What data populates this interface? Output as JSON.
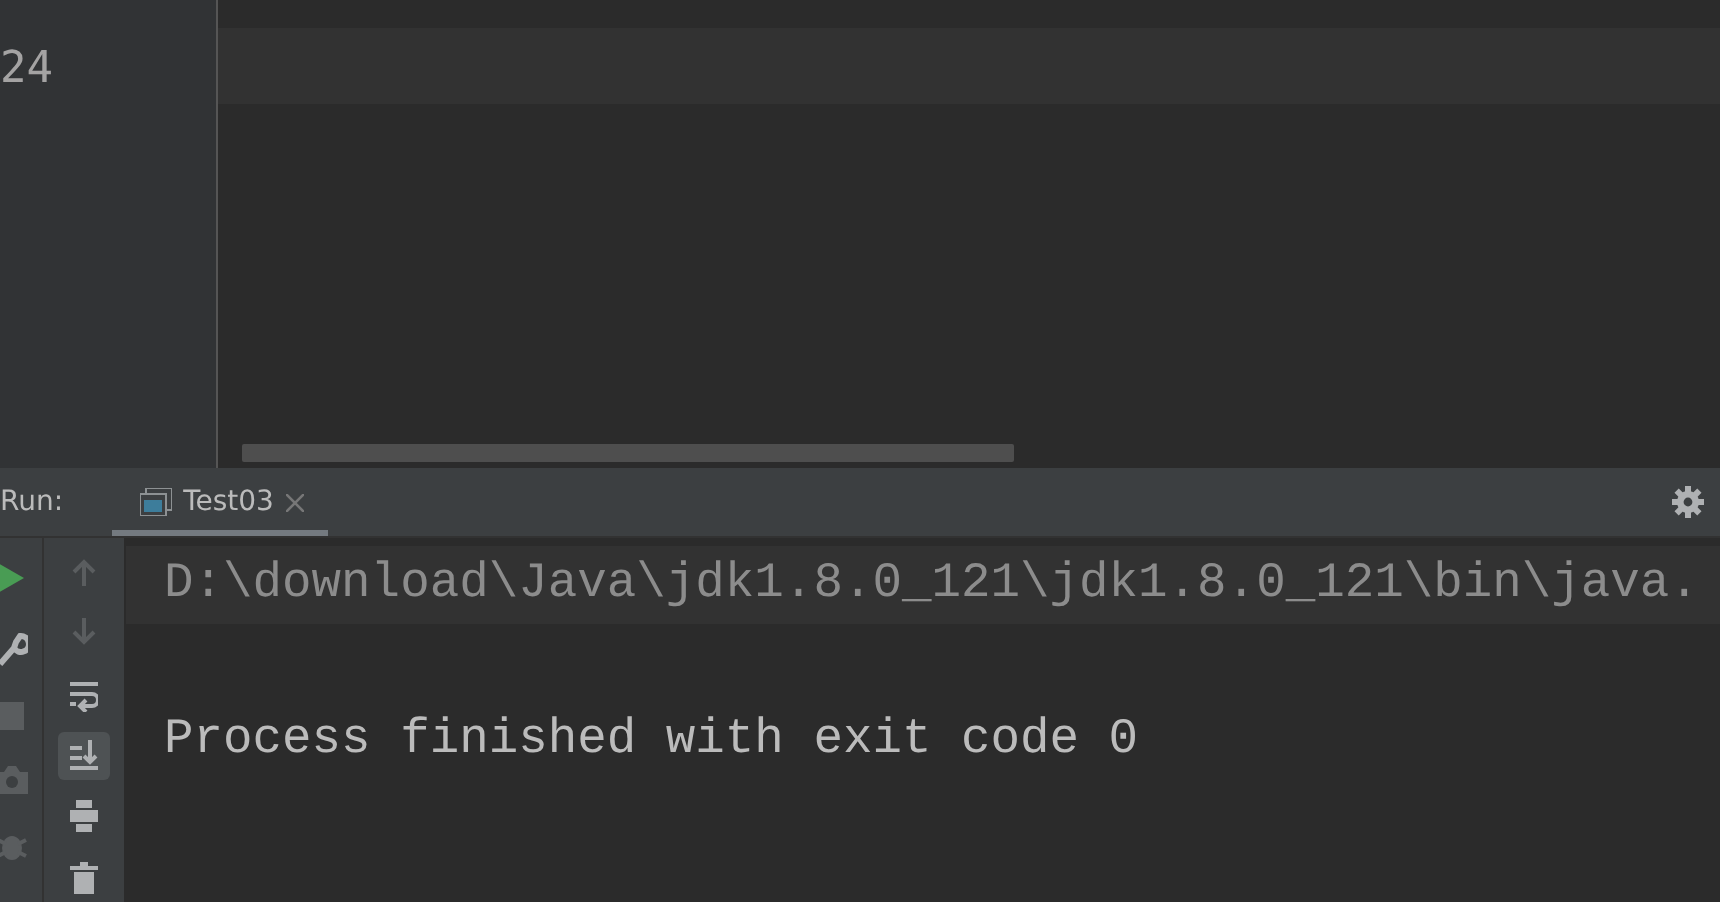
{
  "editor": {
    "line_numbers": [
      "24"
    ]
  },
  "run_panel": {
    "label": "Run:",
    "tabs": [
      {
        "label": "Test03",
        "selected": true
      }
    ],
    "left_tools": [
      {
        "kind": "rerun"
      },
      {
        "kind": "settings"
      },
      {
        "kind": "stop"
      },
      {
        "kind": "camera"
      },
      {
        "kind": "bug"
      }
    ],
    "console_tools": [
      {
        "kind": "up",
        "disabled": true
      },
      {
        "kind": "down",
        "disabled": true
      },
      {
        "kind": "wrap",
        "selected": false
      },
      {
        "kind": "scroll-end",
        "selected": true
      },
      {
        "kind": "print"
      },
      {
        "kind": "trash"
      }
    ],
    "console_lines": [
      {
        "text": "D:\\download\\Java\\jdk1.8.0_121\\jdk1.8.0_121\\bin\\java.",
        "kind": "command"
      },
      {
        "kind": "blank"
      },
      {
        "text": "Process finished with exit code 0",
        "kind": "output"
      }
    ]
  }
}
